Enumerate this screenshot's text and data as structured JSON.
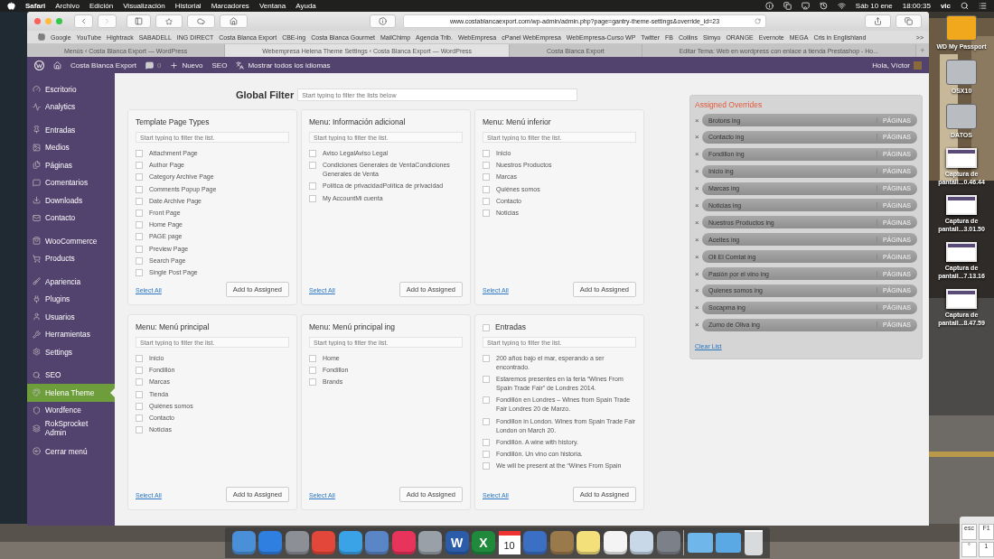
{
  "menu_bar": {
    "app": "Safari",
    "menus": [
      "Archivo",
      "Edición",
      "Visualización",
      "Historial",
      "Marcadores",
      "Ventana",
      "Ayuda"
    ],
    "date": "Sáb 10 ene",
    "time": "18:00:35",
    "user": "vic"
  },
  "browser": {
    "url": "www.costablancaexport.com/wp-admin/admin.php?page=gantry-theme-settings&override_id=23",
    "bookmarks": [
      "Google",
      "YouTube",
      "Hightrack",
      "SABADELL",
      "ING DIRECT",
      "Costa Blanca Export",
      "CBE-ing",
      "Costa Blanca Gourmet",
      "MailChimp",
      "Agencia Trib.",
      "WebEmpresa",
      "cPanel WebEmpresa",
      "WebEmpresa-Curso WP",
      "Twitter",
      "FB",
      "Collins",
      "Simyo",
      "ORANGE",
      "Evernote",
      "MEGA",
      "Cris in Englishland"
    ],
    "more_bookmarks": ">>",
    "tabs": [
      {
        "label": "Menús ‹ Costa Blanca Export — WordPress",
        "selected": false
      },
      {
        "label": "Webempresa Helena Theme Settings ‹ Costa Blanca Export — WordPress",
        "selected": true
      },
      {
        "label": "Costa Blanca Export",
        "selected": false
      },
      {
        "label": "Editar Tema: Web en wordpress con enlace a tienda Prestashop - Ho...",
        "selected": false
      }
    ],
    "new_tab": "+"
  },
  "admin_bar": {
    "site": "Costa Blanca Export",
    "comments": "0",
    "new": "Nuevo",
    "seo": "SEO",
    "languages": "Mostrar todos los idiomas",
    "greeting": "Hola, Víctor"
  },
  "sidebar": {
    "sections": [
      {
        "items": [
          {
            "label": "Escritorio",
            "selected": false
          },
          {
            "label": "Analytics",
            "selected": false
          }
        ]
      },
      {
        "items": [
          {
            "label": "Entradas",
            "selected": false
          },
          {
            "label": "Medios",
            "selected": false
          },
          {
            "label": "Páginas",
            "selected": false
          },
          {
            "label": "Comentarios",
            "selected": false
          },
          {
            "label": "Downloads",
            "selected": false
          },
          {
            "label": "Contacto",
            "selected": false
          }
        ]
      },
      {
        "items": [
          {
            "label": "WooCommerce",
            "selected": false
          },
          {
            "label": "Products",
            "selected": false
          }
        ]
      },
      {
        "items": [
          {
            "label": "Apariencia",
            "selected": false
          },
          {
            "label": "Plugins",
            "selected": false
          },
          {
            "label": "Usuarios",
            "selected": false
          },
          {
            "label": "Herramientas",
            "selected": false
          },
          {
            "label": "Settings",
            "selected": false
          }
        ]
      },
      {
        "items": [
          {
            "label": "SEO",
            "selected": false
          },
          {
            "label": "Helena Theme",
            "selected": true
          },
          {
            "label": "Wordfence",
            "selected": false
          },
          {
            "label": "RokSprocket Admin",
            "selected": false
          }
        ]
      },
      {
        "items": [
          {
            "label": "Cerrar menú",
            "selected": false
          }
        ]
      }
    ]
  },
  "global_filter": {
    "label": "Global Filter",
    "placeholder": "Start typing to filter the lists below"
  },
  "panels": [
    {
      "kind": "plain",
      "title": "Template Page Types",
      "placeholder": "Start typing to filter the list.",
      "items": [
        {
          "label": "Attachment Page",
          "checked": false
        },
        {
          "label": "Author Page",
          "checked": false
        },
        {
          "label": "Category Archive Page",
          "checked": false
        },
        {
          "label": "Comments Popup Page",
          "checked": false
        },
        {
          "label": "Date Archive Page",
          "checked": false
        },
        {
          "label": "Front Page",
          "checked": false
        },
        {
          "label": "Home Page",
          "checked": false
        },
        {
          "label": "PAGE page",
          "checked": false
        },
        {
          "label": "Preview Page",
          "checked": false
        },
        {
          "label": "Search Page",
          "checked": false
        },
        {
          "label": "Single Post Page",
          "checked": false
        }
      ],
      "select_all": "Select All",
      "button": "Add to Assigned"
    },
    {
      "kind": "plain",
      "title": "Menu: Información adicional",
      "placeholder": "Start typing to filter the list.",
      "items": [
        {
          "label": "Aviso LegalAviso Legal",
          "checked": false
        },
        {
          "label": "Condiciones Generales de VentaCondiciones Generales de Venta",
          "checked": false
        },
        {
          "label": "Política de privacidadPolítica de privacidad",
          "checked": false
        },
        {
          "label": "My AccountMi cuenta",
          "checked": false
        }
      ],
      "select_all": "Select All",
      "button": "Add to Assigned"
    },
    {
      "kind": "plain",
      "title": "Menu: Menú inferior",
      "placeholder": "Start typing to filter the list.",
      "items": [
        {
          "label": "Inicio",
          "checked": false
        },
        {
          "label": "Nuestros Productos",
          "checked": false
        },
        {
          "label": "Marcas",
          "checked": false
        },
        {
          "label": "Quiénes somos",
          "checked": false
        },
        {
          "label": "Contacto",
          "checked": false
        },
        {
          "label": "Noticias",
          "checked": false
        }
      ],
      "select_all": "Select All",
      "button": "Add to Assigned"
    },
    {
      "kind": "plain",
      "title": "Menu: Menú principal",
      "placeholder": "Start typing to filter the list.",
      "items": [
        {
          "label": "Inicio",
          "checked": false
        },
        {
          "label": "Fondillón",
          "checked": false
        },
        {
          "label": "Marcas",
          "checked": false
        },
        {
          "label": "Tienda",
          "checked": false
        },
        {
          "label": "Quiénes somos",
          "checked": false
        },
        {
          "label": "Contacto",
          "checked": false
        },
        {
          "label": "Noticias",
          "checked": false
        }
      ],
      "select_all": "Select All",
      "button": "Add to Assigned"
    },
    {
      "kind": "plain",
      "title": "Menu: Menú principal ing",
      "placeholder": "Start typing to filter the list.",
      "items": [
        {
          "label": "Home",
          "checked": false
        },
        {
          "label": "Fondillon",
          "checked": false
        },
        {
          "label": "Brands",
          "checked": false
        }
      ],
      "select_all": "Select All",
      "button": "Add to Assigned"
    },
    {
      "kind": "checkable",
      "title": "Entradas",
      "title_checked": false,
      "placeholder": "Start typing to filter the list.",
      "items": [
        {
          "label": "200 años bajo el mar, esperando a ser encontrado.",
          "checked": false
        },
        {
          "label": "Estaremos presentes en la feria “Wines From Spain Trade Fair” de Londres 2014.",
          "checked": false
        },
        {
          "label": "Fondillón en Londres – Wines from Spain Trade Fair Londres 20 de Marzo.",
          "checked": false
        },
        {
          "label": "Fondillon in London. Wines from Spain Trade Fair London on March 20.",
          "checked": false
        },
        {
          "label": "Fondillón. A wine with history.",
          "checked": false
        },
        {
          "label": "Fondillón. Un vino con historia.",
          "checked": false
        },
        {
          "label": "We will be present at the “Wines From Spain",
          "checked": false
        }
      ],
      "select_all": "Select All",
      "button": "Add to Assigned"
    }
  ],
  "assigned_overrides": {
    "title": "Assigned Overrides",
    "remove": "×",
    "items": [
      {
        "label": "Brotons ing",
        "tag": "PÁGINAS"
      },
      {
        "label": "Contacto ing",
        "tag": "PÁGINAS"
      },
      {
        "label": "Fondillon ing",
        "tag": "PÁGINAS"
      },
      {
        "label": "Inicio ing",
        "tag": "PÁGINAS"
      },
      {
        "label": "Marcas ing",
        "tag": "PÁGINAS"
      },
      {
        "label": "Noticias ing",
        "tag": "PÁGINAS"
      },
      {
        "label": "Nuestros Productos ing",
        "tag": "PÁGINAS"
      },
      {
        "label": "Aceites ing",
        "tag": "PÁGINAS"
      },
      {
        "label": "Oli El Comtat ing",
        "tag": "PÁGINAS"
      },
      {
        "label": "Pasión por el vino ing",
        "tag": "PÁGINAS"
      },
      {
        "label": "Quienes somos ing",
        "tag": "PÁGINAS"
      },
      {
        "label": "Socapma ing",
        "tag": "PÁGINAS"
      },
      {
        "label": "Zumo de Oliva ing",
        "tag": "PÁGINAS"
      }
    ],
    "clear": "Clear List"
  },
  "desktop_icons": [
    {
      "kind": "drive",
      "color": "#f2a81d",
      "label": "WD My Passport"
    },
    {
      "kind": "drive",
      "color": "#b9bcc0",
      "label": "OSX10"
    },
    {
      "kind": "drive",
      "color": "#b9bcc0",
      "label": "DATOS"
    },
    {
      "kind": "screenshot",
      "label": "Captura de pantall...0.46.44"
    },
    {
      "kind": "screenshot",
      "label": "Captura de pantall...3.01.50"
    },
    {
      "kind": "screenshot",
      "label": "Captura de pantall...7.13.16"
    },
    {
      "kind": "screenshot",
      "label": "Captura de pantall...8.47.59"
    }
  ],
  "keyboard_viewer": {
    "keys": [
      "esc",
      "F1",
      "°",
      "1"
    ]
  },
  "dock": [
    {
      "kind": "app",
      "color": "#4a90d9"
    },
    {
      "kind": "app",
      "color": "#2f7fe0"
    },
    {
      "kind": "app",
      "color": "#8c8f96"
    },
    {
      "kind": "app",
      "color": "#e2473a"
    },
    {
      "kind": "app",
      "color": "#3aa3e8"
    },
    {
      "kind": "app",
      "color": "#5a86c8"
    },
    {
      "kind": "app",
      "color": "#e8335a"
    },
    {
      "kind": "app",
      "color": "#9aa0a8"
    },
    {
      "kind": "app",
      "color": "#2a5caa",
      "text": "W"
    },
    {
      "kind": "app",
      "color": "#1f8a3c",
      "text": "X"
    },
    {
      "kind": "calendar",
      "color": "#ffffff",
      "text": "10"
    },
    {
      "kind": "app",
      "color": "#3b6fc4"
    },
    {
      "kind": "app",
      "color": "#9a7a4a"
    },
    {
      "kind": "app",
      "color": "#f3e07a"
    },
    {
      "kind": "app",
      "color": "#f4f4f4"
    },
    {
      "kind": "app",
      "color": "#c8d8e8"
    },
    {
      "kind": "app",
      "color": "#7c8088"
    },
    {
      "kind": "separator"
    },
    {
      "kind": "folder",
      "color": "#6fb6ea"
    },
    {
      "kind": "folder",
      "color": "#5aa8e4"
    },
    {
      "kind": "trash",
      "color": "#d8dadc"
    }
  ]
}
